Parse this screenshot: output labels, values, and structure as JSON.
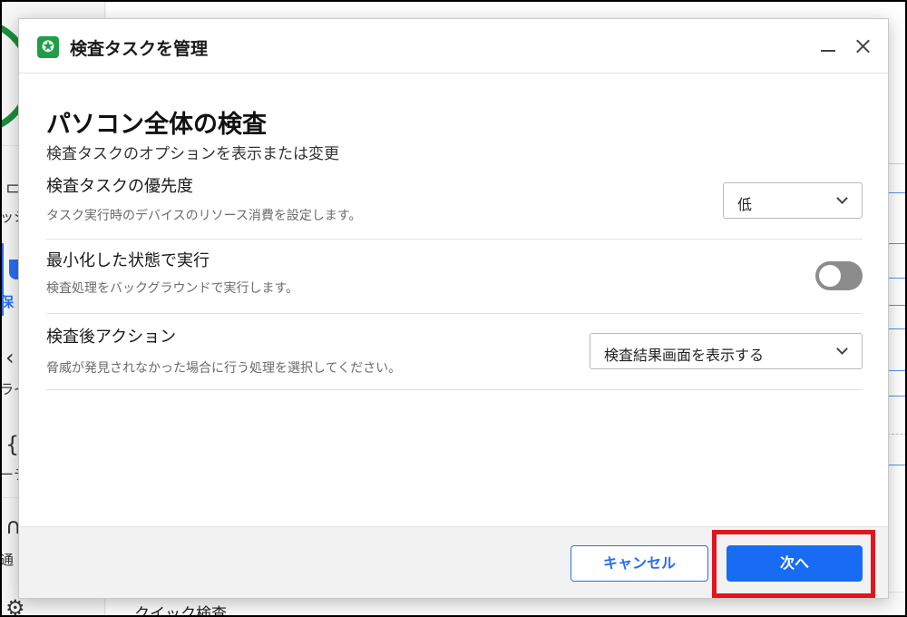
{
  "background_app": {
    "nav_icons": [
      "calendar-icon",
      "shield-icon",
      "chevron-left-icon",
      "puzzle-icon",
      "bell-icon",
      "gear-icon"
    ],
    "nav_fragments": [
      "ッシ",
      "保",
      "ライ",
      "ーテ",
      "通"
    ],
    "bottom_item": "クイック検査"
  },
  "dialog": {
    "title": "検査タスクを管理",
    "logo_glyph": "✪",
    "page_title": "パソコン全体の検査",
    "page_subtitle": "検査タスクのオプションを表示または変更",
    "settings": {
      "priority": {
        "label": "検査タスクの優先度",
        "description": "タスク実行時のデバイスのリソース消費を設定します。",
        "selected": "低"
      },
      "minimized": {
        "label": "最小化した状態で実行",
        "description": "検査処理をバックグラウンドで実行します。",
        "enabled": false
      },
      "post_action": {
        "label": "検査後アクション",
        "description": "脅威が発見されなかった場合に行う処理を選択してください。",
        "selected": "検査結果画面を表示する"
      }
    },
    "footer": {
      "cancel_label": "キャンセル",
      "next_label": "次へ"
    }
  },
  "colors": {
    "accent": "#176cf3",
    "brand_green": "#1f9d47",
    "highlight_red": "#e0161d",
    "toggle_off": "#8c8c8c"
  }
}
